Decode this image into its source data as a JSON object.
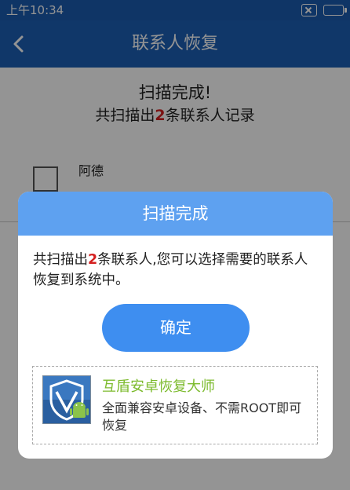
{
  "status_bar": {
    "time": "上午10:34"
  },
  "header": {
    "title": "联系人恢复"
  },
  "main": {
    "scan_done": "扫描完成!",
    "summary_prefix": "共扫描出",
    "summary_count": "2",
    "summary_suffix": "条联系人记录",
    "contacts": [
      {
        "name": "阿德"
      }
    ]
  },
  "dialog": {
    "title": "扫描完成",
    "message_prefix": "共扫描出",
    "message_count": "2",
    "message_suffix": "条联系人,您可以选择需要的联系人恢复到系统中。",
    "confirm_label": "确定",
    "ad": {
      "title": "互盾安卓恢复大师",
      "description": "全面兼容安卓设备、不需ROOT即可恢复"
    }
  },
  "colors": {
    "header_bg": "#1d5fb5",
    "dialog_header_bg": "#5ea1f0",
    "confirm_bg": "#3e8ef0",
    "count_red": "#d42020",
    "ad_title_green": "#7dbb2e"
  },
  "icons": [
    "back-arrow-icon",
    "close-box-icon",
    "battery-icon",
    "shield-android-logo-icon"
  ]
}
